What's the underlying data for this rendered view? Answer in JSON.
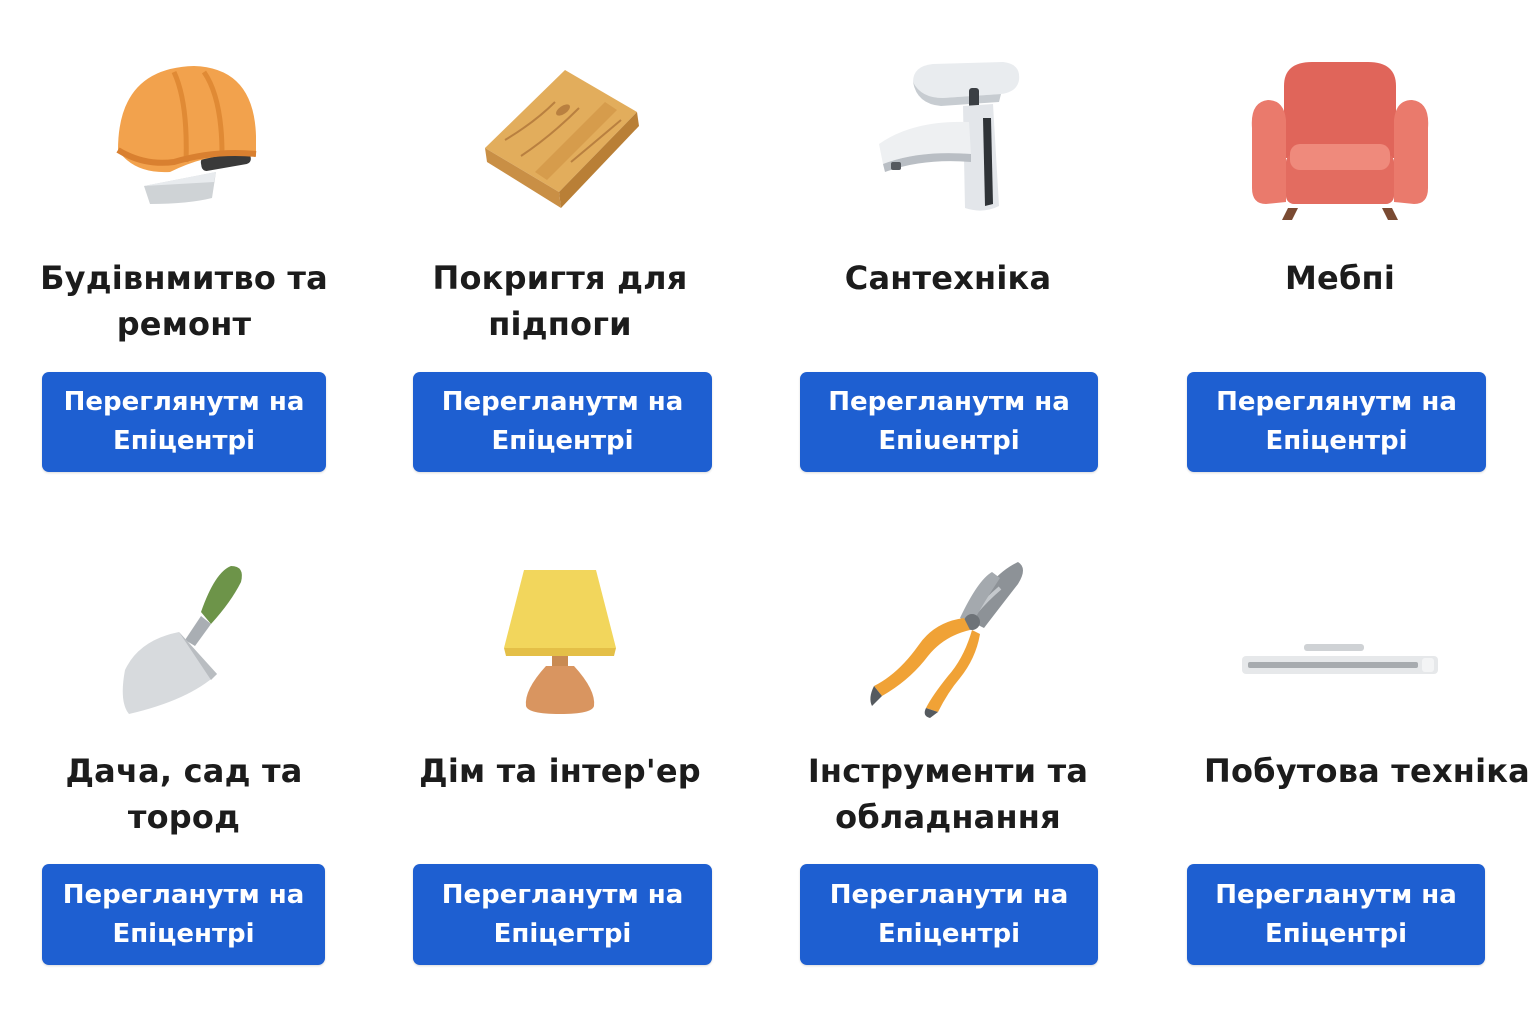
{
  "colors": {
    "button_bg": "#1e5fd1",
    "button_text": "#ffffff",
    "title_text": "#1c1c1c",
    "background": "#ffffff"
  },
  "categories": [
    {
      "icon": "hard-hat-icon",
      "title_line1": "Будівнмитво та",
      "title_line2": "ремонт",
      "button_line1": "Переглянутм на",
      "button_line2": "Епіцентрі"
    },
    {
      "icon": "wood-plank-icon",
      "title_line1": "Покригтя для",
      "title_line2": "підпоги",
      "button_line1": "Перегланутм на",
      "button_line2": "Епіцентрі"
    },
    {
      "icon": "faucet-icon",
      "title_line1": "Сантехніка",
      "title_line2": "",
      "button_line1": "Перегланутм на",
      "button_line2": "Епіuентрі"
    },
    {
      "icon": "armchair-icon",
      "title_line1": "Мебпі",
      "title_line2": "",
      "button_line1": "Переглянутм на",
      "button_line2": "Епіцентрі"
    },
    {
      "icon": "trowel-icon",
      "title_line1": "Дача, сад та",
      "title_line2": "тород",
      "button_line1": "Перегланутм на",
      "button_line2": "Епіцентрі"
    },
    {
      "icon": "table-lamp-icon",
      "title_line1": "Дім та інтер'ер",
      "title_line2": "",
      "button_line1": "Перегланутм на",
      "button_line2": "Епіцегтрі"
    },
    {
      "icon": "pliers-icon",
      "title_line1": "Інструменти та",
      "title_line2": "обладнання",
      "button_line1": "Перегланути на",
      "button_line2": "Епіцентрі"
    },
    {
      "icon": "appliance-icon",
      "title_line1": "Побутова техніка",
      "title_line2": "",
      "button_line1": "Перегланутм на",
      "button_line2": "Епіцентрі"
    }
  ]
}
